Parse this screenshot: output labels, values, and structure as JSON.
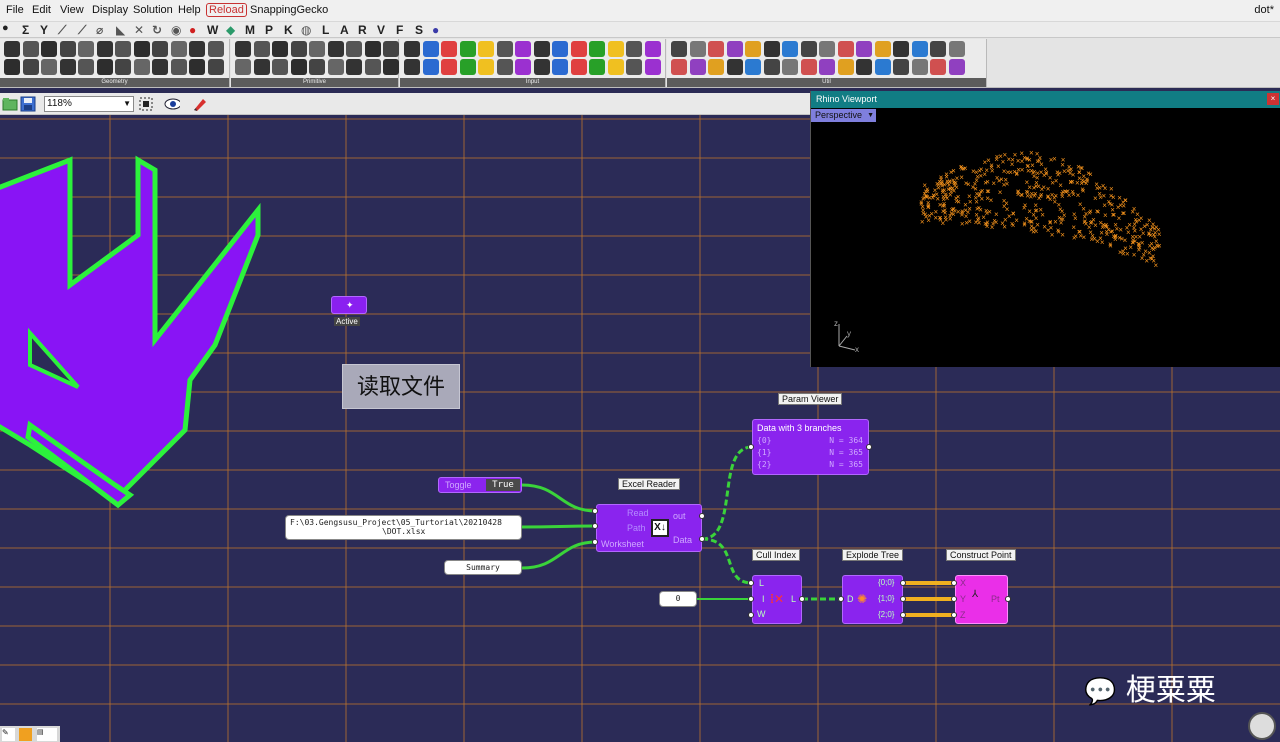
{
  "menu": {
    "items": [
      "File",
      "Edit",
      "View",
      "Display",
      "Solution",
      "Help"
    ],
    "reload": "Reload",
    "plugin": "SnappingGecko",
    "document": "dot*"
  },
  "tab_categories": [
    "Σ",
    "Y",
    "W",
    "M",
    "P",
    "K",
    "L",
    "A",
    "R",
    "V",
    "F",
    "S"
  ],
  "ribbon_groups": [
    "Geometry",
    "Primitive",
    "Input",
    "Util"
  ],
  "toolbar": {
    "zoom": "118%"
  },
  "canvas": {
    "active_label": "Active",
    "group_label": "读取文件",
    "toggle": {
      "name": "Toggle",
      "value": "True"
    },
    "path_panel": {
      "line1": "F:\\03.Gengsusu_Project\\05_Turtorial\\20210428",
      "line2": "\\DOT.xlsx"
    },
    "summary_panel": "Summary",
    "zero_panel": "0",
    "excel_reader": {
      "title": "Excel Reader",
      "inputs": [
        "Read",
        "Path",
        "Worksheet"
      ],
      "outputs": [
        "out",
        "Data"
      ]
    },
    "param_viewer": {
      "title": "Param Viewer",
      "header": "Data with 3 branches",
      "rows": [
        {
          "path": "{0}",
          "count": "N = 364"
        },
        {
          "path": "{1}",
          "count": "N = 365"
        },
        {
          "path": "{2}",
          "count": "N = 365"
        }
      ]
    },
    "cull_index": {
      "title": "Cull Index",
      "inputs": [
        "L",
        "I",
        "W"
      ],
      "output": "L"
    },
    "explode_tree": {
      "title": "Explode Tree",
      "input": "D",
      "outputs": [
        "{0;0}",
        "{1;0}",
        "{2;0}"
      ]
    },
    "construct_point": {
      "title": "Construct Point",
      "inputs": [
        "X",
        "Y",
        "Z"
      ],
      "output": "Pt"
    }
  },
  "viewport": {
    "title": "Rhino Viewport",
    "view": "Perspective",
    "axes": {
      "z": "z",
      "y": "y",
      "x": "x"
    },
    "point_color": "#f7941d"
  },
  "watermark": "梗粟粟",
  "colors": {
    "canvas": "#2b2b57",
    "grid": "#b9722c",
    "component": "#8a24ee",
    "wire": "#3ad33a",
    "construct_point": "#ea2fe8",
    "logo_outline": "#2cf23c"
  }
}
